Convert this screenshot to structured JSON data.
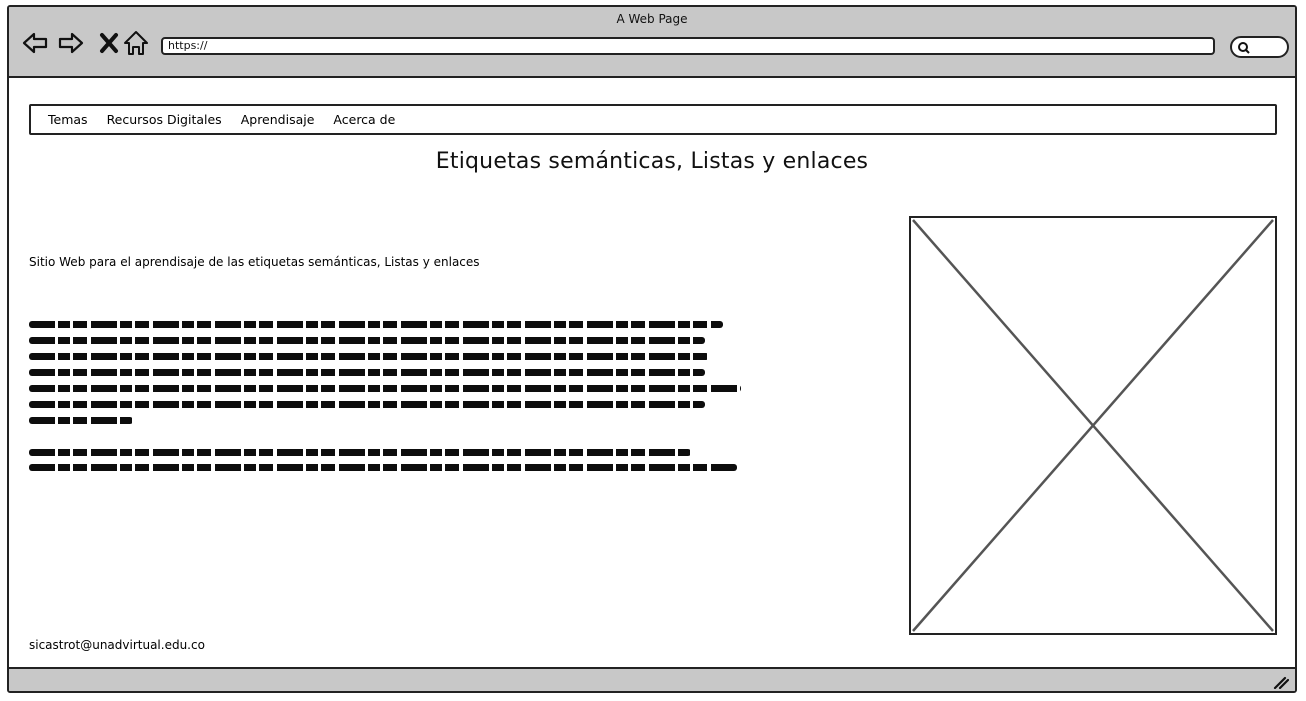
{
  "window": {
    "title": "A Web Page"
  },
  "browser": {
    "url": "https://",
    "icons": [
      "back-arrow-icon",
      "forward-arrow-icon",
      "close-icon",
      "home-icon",
      "search-icon"
    ]
  },
  "nav": {
    "items": [
      "Temas",
      "Recursos Digitales",
      "Aprendisaje",
      "Acerca de"
    ]
  },
  "main": {
    "title": "Etiquetas semánticas, Listas y enlaces",
    "subtitle": "Sitio Web para el aprendisaje de las etiquetas semánticas, Listas y enlaces",
    "email": "sicastrot@unadvirtual.edu.co"
  }
}
